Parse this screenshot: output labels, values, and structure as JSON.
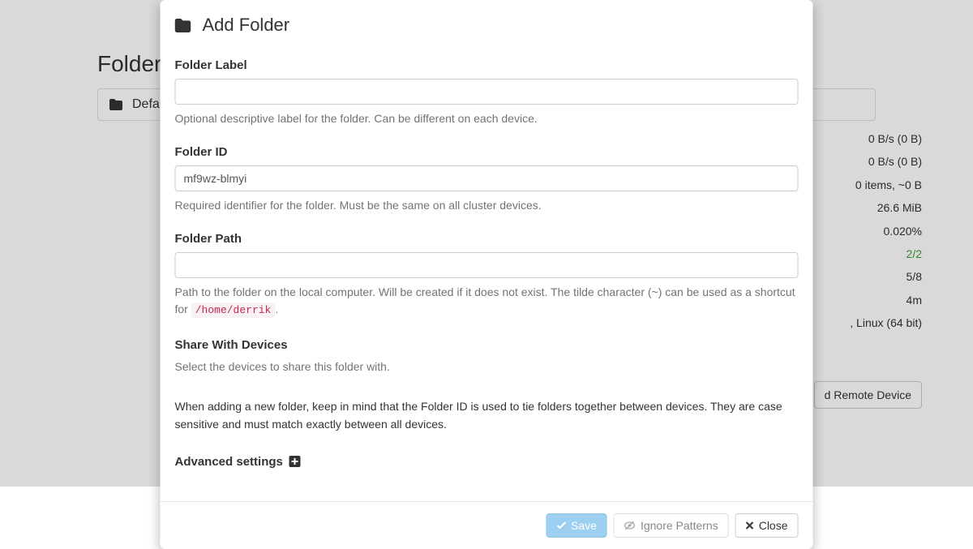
{
  "page": {
    "folders_heading": "Folders",
    "default_folder_label": "Default"
  },
  "stats": {
    "down_rate": "0 B/s (0 B)",
    "up_rate": "0 B/s (0 B)",
    "local_state": "0 items, ~0 B",
    "ram": "26.6 MiB",
    "cpu": "0.020%",
    "listeners": "2/2",
    "discovery": "5/8",
    "uptime": "4m",
    "version_tail": ", Linux (64 bit)"
  },
  "buttons": {
    "add_remote_device_tail": "d Remote Device"
  },
  "modal": {
    "title": "Add Folder",
    "label_field": {
      "label": "Folder Label",
      "value": "",
      "help": "Optional descriptive label for the folder. Can be different on each device."
    },
    "id_field": {
      "label": "Folder ID",
      "value": "mf9wz-blmyi",
      "help": "Required identifier for the folder. Must be the same on all cluster devices."
    },
    "path_field": {
      "label": "Folder Path",
      "value": "",
      "help_pre": "Path to the folder on the local computer. Will be created if it does not exist. The tilde character (~) can be used as a shortcut for ",
      "help_code": "/home/derrik",
      "help_post": "."
    },
    "share": {
      "title": "Share With Devices",
      "text": "Select the devices to share this folder with."
    },
    "note": "When adding a new folder, keep in mind that the Folder ID is used to tie folders together between devices. They are case sensitive and must match exactly between all devices.",
    "advanced_label": "Advanced settings",
    "footer": {
      "save": "Save",
      "ignore": "Ignore Patterns",
      "close": "Close"
    }
  }
}
